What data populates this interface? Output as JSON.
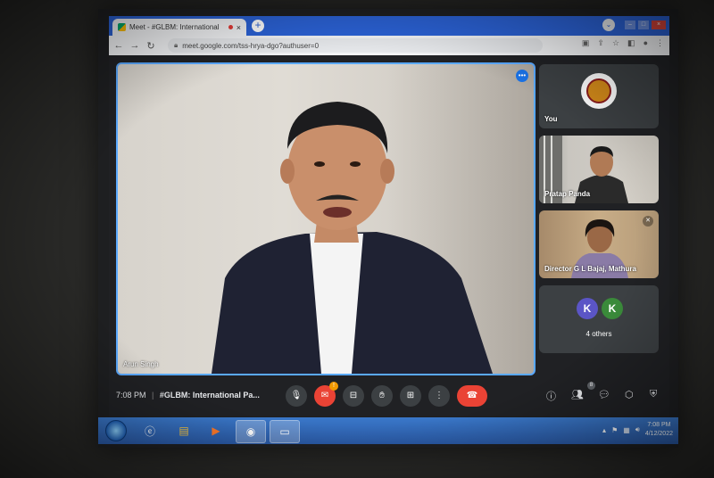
{
  "browser": {
    "tab_title": "Meet - #GLBM: International",
    "tab_close": "×",
    "new_tab": "+",
    "url": "meet.google.com/tss-hrya-dgo?authuser=0",
    "nav": {
      "back": "←",
      "forward": "→",
      "reload": "↻"
    },
    "window": {
      "minimize": "–",
      "maximize": "□",
      "close": "×"
    }
  },
  "meet": {
    "main_speaker": "Arun Singh",
    "tiles": [
      {
        "name": "You"
      },
      {
        "name": "Pratap Panda"
      },
      {
        "name": "Director G L Bajaj, Mathura"
      }
    ],
    "others": {
      "avatars": [
        "K",
        "K"
      ],
      "label": "4 others",
      "colors": [
        "#5b55c6",
        "#3a8a3a"
      ]
    },
    "time": "7:08 PM",
    "separator": "|",
    "meeting_name": "#GLBM: International Pa...",
    "chat_badge": "!",
    "participants_count": "8"
  },
  "taskbar": {
    "time": "7:08 PM",
    "date": "4/12/2022"
  },
  "colors": {
    "accent": "#1a73e8",
    "end_call": "#ea4335",
    "chrome_blue": "#2b62d6"
  }
}
